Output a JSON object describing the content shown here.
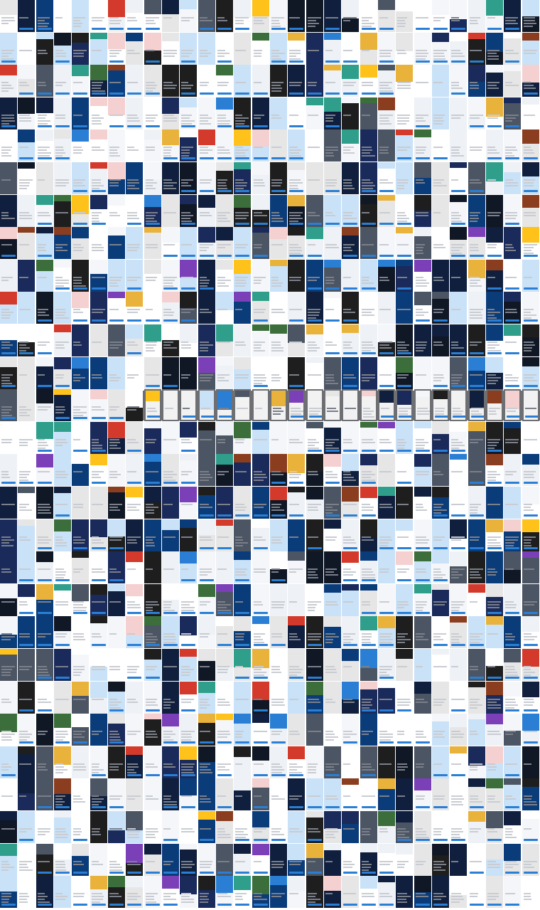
{
  "grid": {
    "cols": 30,
    "rows": 28
  },
  "palette": [
    "#ffffff",
    "#f4f6f9",
    "#1a2a5a",
    "#0f1f3d",
    "#2a7fd4",
    "#d33a2c",
    "#1e1e1e",
    "#3b6e3a",
    "#e9b23b",
    "#7b3fb8",
    "#c9e2f7",
    "#eef1f5",
    "#0b3c7a",
    "#8a3d1f",
    "#2f9e8a",
    "#f5d0d0",
    "#101725",
    "#4c5563",
    "#ffc21a",
    "#e6e6e6"
  ],
  "bands": [
    {
      "row": 12,
      "note": ""
    }
  ],
  "tile_kinds": [
    "light",
    "dark",
    "image",
    "brand"
  ]
}
